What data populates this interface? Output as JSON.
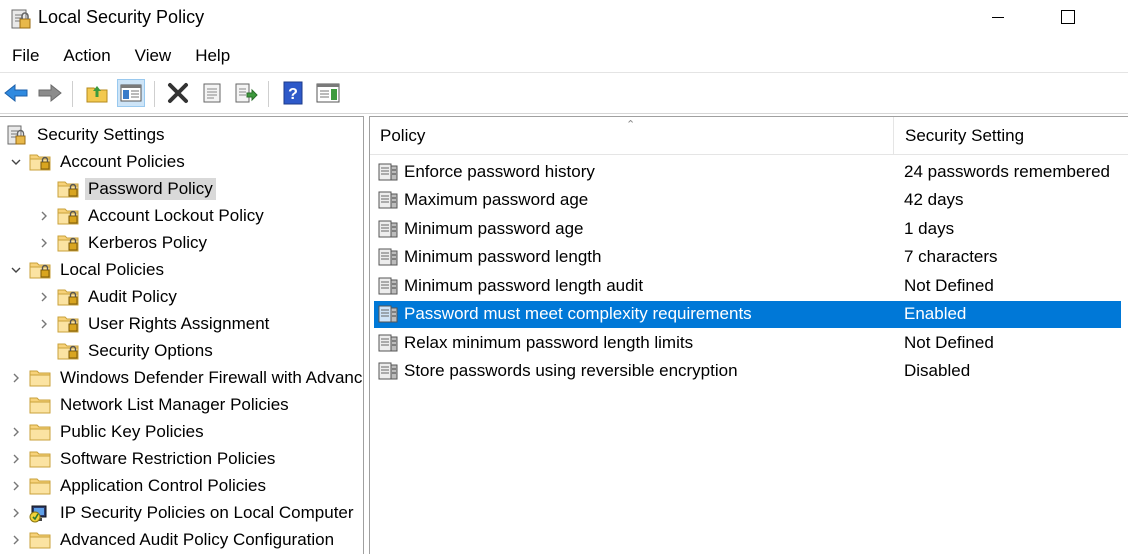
{
  "window": {
    "title": "Local Security Policy"
  },
  "menu": [
    "File",
    "Action",
    "View",
    "Help"
  ],
  "tree": {
    "root": "Security Settings",
    "items": [
      {
        "label": "Account Policies",
        "level": 1,
        "expander": "expanded"
      },
      {
        "label": "Password Policy",
        "level": 2,
        "expander": "none",
        "selected": true
      },
      {
        "label": "Account Lockout Policy",
        "level": 2,
        "expander": "collapsed"
      },
      {
        "label": "Kerberos Policy",
        "level": 2,
        "expander": "collapsed"
      },
      {
        "label": "Local Policies",
        "level": 1,
        "expander": "expanded"
      },
      {
        "label": "Audit Policy",
        "level": 2,
        "expander": "collapsed"
      },
      {
        "label": "User Rights Assignment",
        "level": 2,
        "expander": "collapsed"
      },
      {
        "label": "Security Options",
        "level": 2,
        "expander": "none"
      },
      {
        "label": "Windows Defender Firewall with Advanced Security",
        "level": 1,
        "expander": "collapsed",
        "plain": true
      },
      {
        "label": "Network List Manager Policies",
        "level": 1,
        "expander": "none",
        "plain": true
      },
      {
        "label": "Public Key Policies",
        "level": 1,
        "expander": "collapsed",
        "plain": true
      },
      {
        "label": "Software Restriction Policies",
        "level": 1,
        "expander": "collapsed",
        "plain": true
      },
      {
        "label": "Application Control Policies",
        "level": 1,
        "expander": "collapsed",
        "plain": true
      },
      {
        "label": "IP Security Policies on Local Computer",
        "level": 1,
        "expander": "collapsed",
        "ipsec": true
      },
      {
        "label": "Advanced Audit Policy Configuration",
        "level": 1,
        "expander": "collapsed",
        "plain": true
      }
    ]
  },
  "list": {
    "columns": {
      "policy": "Policy",
      "setting": "Security Setting"
    },
    "rows": [
      {
        "policy": "Enforce password history",
        "setting": "24 passwords remembered"
      },
      {
        "policy": "Maximum password age",
        "setting": "42 days"
      },
      {
        "policy": "Minimum password age",
        "setting": "1 days"
      },
      {
        "policy": "Minimum password length",
        "setting": "7 characters"
      },
      {
        "policy": "Minimum password length audit",
        "setting": "Not Defined"
      },
      {
        "policy": "Password must meet complexity requirements",
        "setting": "Enabled",
        "selected": true
      },
      {
        "policy": "Relax minimum password length limits",
        "setting": "Not Defined"
      },
      {
        "policy": "Store passwords using reversible encryption",
        "setting": "Disabled"
      }
    ]
  },
  "icons": {
    "toolbar": [
      "back-arrow-icon",
      "forward-arrow-icon",
      "up-folder-icon",
      "show-hide-tree-icon",
      "delete-icon",
      "properties-icon",
      "export-list-icon",
      "help-icon",
      "show-action-pane-icon"
    ]
  },
  "colors": {
    "selection": "#0078d7",
    "tree_selection": "#d9d9d9"
  }
}
